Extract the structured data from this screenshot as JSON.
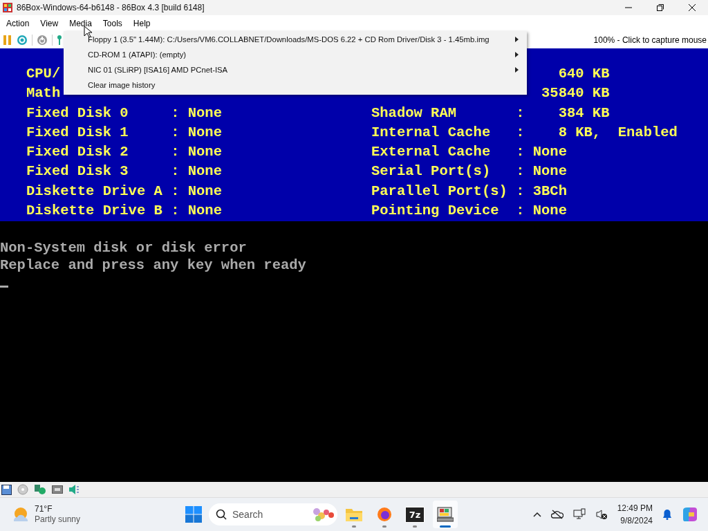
{
  "window": {
    "title": "86Box-Windows-64-b6148 - 86Box 4.3 [build 6148]"
  },
  "menu_bar": [
    "Action",
    "View",
    "Media",
    "Tools",
    "Help"
  ],
  "toolbar": {
    "status": "100% - Click to capture mouse"
  },
  "media_menu": {
    "items": [
      {
        "label": "Floppy 1 (3.5\" 1.44M): C:/Users/VM6.COLLABNET/Downloads/MS-DOS 6.22 + CD Rom Driver/Disk 3 - 1.45mb.img",
        "submenu": true
      },
      {
        "label": "CD-ROM 1 (ATAPI): (empty)",
        "submenu": true
      },
      {
        "label": "NIC 01 (SLiRP) [ISA16] AMD PCnet-ISA",
        "submenu": true
      },
      {
        "label": "Clear image history",
        "submenu": false
      }
    ]
  },
  "screen": {
    "bios_left": [
      {
        "text": "CPU/",
        "kind": "line"
      },
      {
        "text": "Math",
        "kind": "line"
      },
      {
        "text": "Fixed Disk 0     : None",
        "kind": "line"
      },
      {
        "text": "Fixed Disk 1     : None",
        "kind": "line"
      },
      {
        "text": "Fixed Disk 2     : None",
        "kind": "line"
      },
      {
        "text": "Fixed Disk 3     : None",
        "kind": "line"
      },
      {
        "text": "Diskette Drive A : None",
        "kind": "line"
      },
      {
        "text": "Diskette Drive B : None",
        "kind": "line"
      }
    ],
    "bios_right": [
      {
        "text": "640 KB",
        "kind": "covered"
      },
      {
        "text": "35840 KB",
        "kind": "covered"
      },
      {
        "text": "Shadow RAM       :    384 KB",
        "kind": "line"
      },
      {
        "text": "Internal Cache   :    8 KB,  Enabled",
        "kind": "line"
      },
      {
        "text": "External Cache   : None",
        "kind": "line"
      },
      {
        "text": "Serial Port(s)   : None",
        "kind": "line"
      },
      {
        "text": "Parallel Port(s) : 3BCh",
        "kind": "line"
      },
      {
        "text": "Pointing Device  : None",
        "kind": "line"
      }
    ],
    "console": [
      "Non-System disk or disk error",
      "Replace and press any key when ready"
    ]
  },
  "taskbar": {
    "weather": {
      "temperature": "71°F",
      "condition": "Partly sunny"
    },
    "search": {
      "placeholder": "Search"
    },
    "apps": [
      {
        "kind": "folder",
        "active": false
      },
      {
        "kind": "browser",
        "active": false
      },
      {
        "kind": "archiver",
        "label": "7z",
        "active": false
      },
      {
        "kind": "emulator",
        "active": true
      }
    ],
    "time": "12:49 PM",
    "date": "9/8/2024"
  }
}
